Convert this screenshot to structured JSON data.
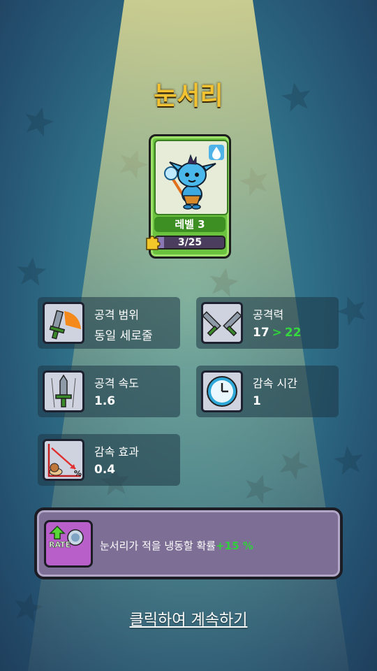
{
  "unit": {
    "name": "눈서리",
    "level_label": "레벨 3",
    "progress_text": "3/25",
    "progress_fraction": 0.12,
    "element_icon": "water-drop-icon"
  },
  "stats": [
    {
      "label": "공격 범위",
      "value": "동일 세로줄",
      "icon": "sword-range-icon"
    },
    {
      "label": "공격력",
      "value": "17",
      "upgrade": "22",
      "icon": "crossed-swords-icon"
    },
    {
      "label": "공격 속도",
      "value": "1.6",
      "icon": "fast-sword-icon"
    },
    {
      "label": "감속 시간",
      "value": "1",
      "icon": "clock-icon"
    },
    {
      "label": "감속 효과",
      "value": "0.4",
      "icon": "snail-slow-icon"
    }
  ],
  "ability": {
    "badge": "RATE",
    "text": "눈서리가 적을 냉동할 확률",
    "bonus": "+15 %"
  },
  "continue_label": "클릭하여 계속하기",
  "colors": {
    "title": "#f2c230",
    "card": "#6bc23f",
    "upgrade": "#2fd03b",
    "ability_panel": "#7d6e96"
  }
}
